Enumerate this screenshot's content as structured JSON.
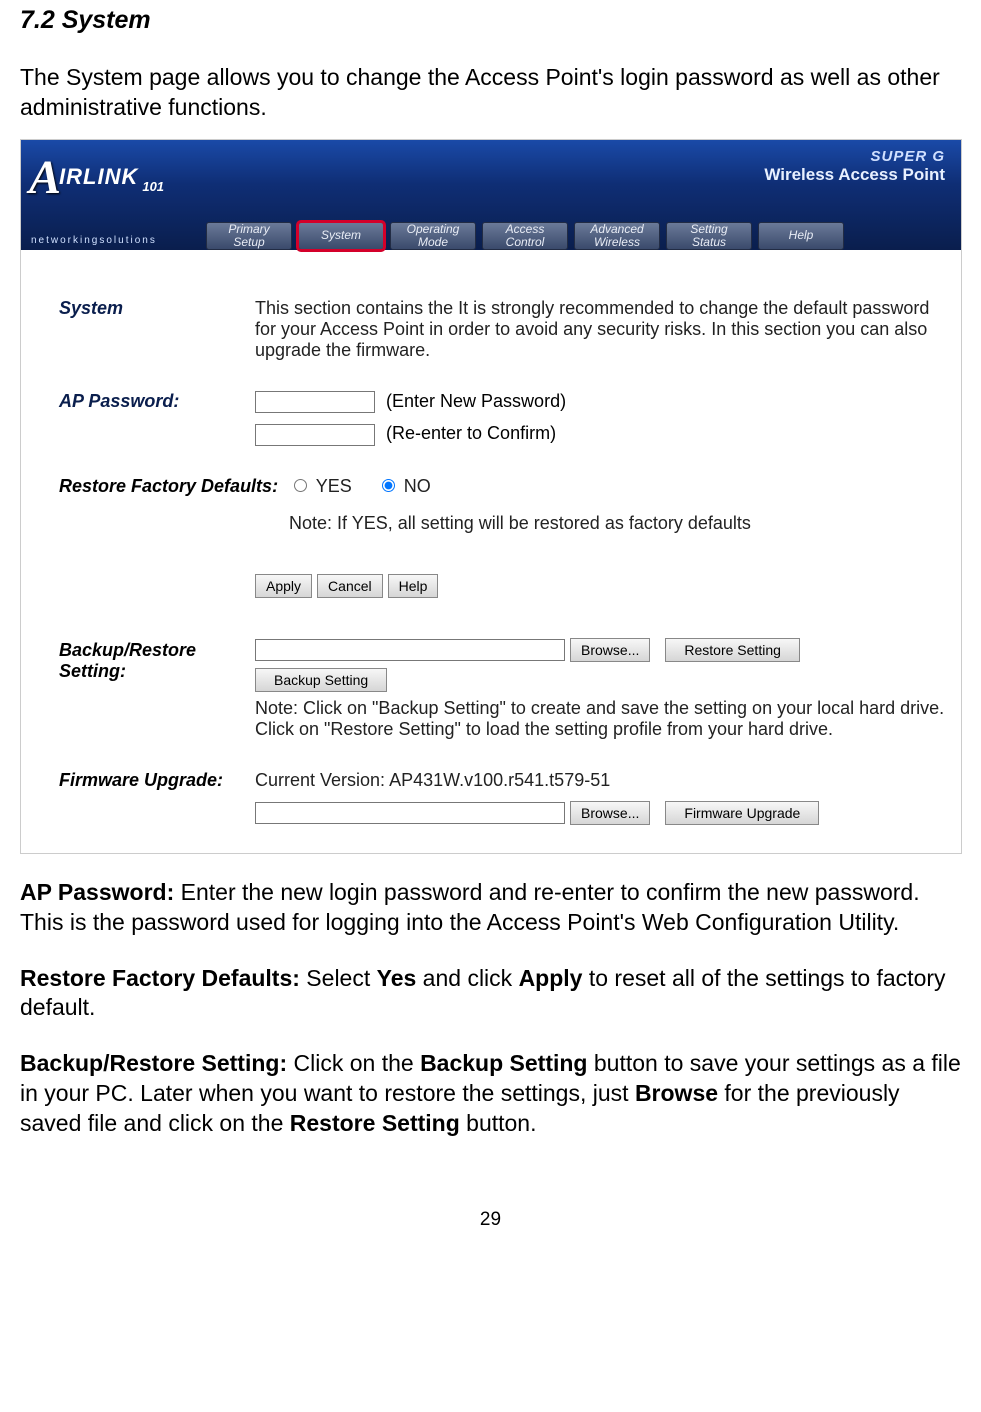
{
  "heading": "7.2 System",
  "intro": "The System page allows you to change the Access Point's login password as well as other administrative functions.",
  "header": {
    "logo_text": "IRLINK",
    "logo_num": "101",
    "ns": "networkingsolutions",
    "super_g": "SUPER G",
    "wap": "Wireless Access Point",
    "tabs": [
      "Primary\nSetup",
      "System",
      "Operating\nMode",
      "Access\nControl",
      "Advanced\nWireless",
      "Setting\nStatus",
      "Help"
    ]
  },
  "system": {
    "label": "System",
    "desc": "This section contains the It is strongly recommended to change the default password for your Access Point in order to avoid any security risks. In this section you can also upgrade the firmware."
  },
  "ap_password": {
    "label": "AP Password:",
    "hint1": "(Enter New Password)",
    "hint2": "(Re-enter to Confirm)"
  },
  "restore_defaults": {
    "label": "Restore Factory Defaults:",
    "yes": "YES",
    "no": "NO",
    "note": "Note: If YES, all setting will be restored as factory defaults"
  },
  "buttons": {
    "apply": "Apply",
    "cancel": "Cancel",
    "help": "Help",
    "browse": "Browse...",
    "restore_setting": "Restore Setting",
    "backup_setting": "Backup Setting",
    "firmware_upgrade": "Firmware Upgrade"
  },
  "backup_restore": {
    "label": "Backup/Restore Setting:",
    "note1": "Note: Click on \"Backup Setting\" to create and save the setting on your local hard drive.",
    "note2": "Click on \"Restore Setting\" to load the setting profile from your hard drive."
  },
  "firmware": {
    "label": "Firmware Upgrade:",
    "version_label": "Current Version: ",
    "version": "AP431W.v100.r541.t579-51"
  },
  "doc": {
    "p1_bold": "AP Password:",
    "p1_rest": " Enter the new login password and re-enter to confirm the new password. This is the password used for logging into the Access Point's Web Configuration Utility.",
    "p2_bold": "Restore Factory Defaults:",
    "p2_a": " Select ",
    "p2_yes": "Yes",
    "p2_b": " and click ",
    "p2_apply": "Apply",
    "p2_c": " to reset all of the settings to factory default.",
    "p3_bold": "Backup/Restore Setting:",
    "p3_a": " Click on the ",
    "p3_backup": "Backup Setting",
    "p3_b": " button to save your settings as a file in your PC. Later when you want to restore the settings, just ",
    "p3_browse": "Browse",
    "p3_c": " for the previously saved file and click on the ",
    "p3_restore": "Restore Setting",
    "p3_d": " button."
  },
  "page_number": "29"
}
